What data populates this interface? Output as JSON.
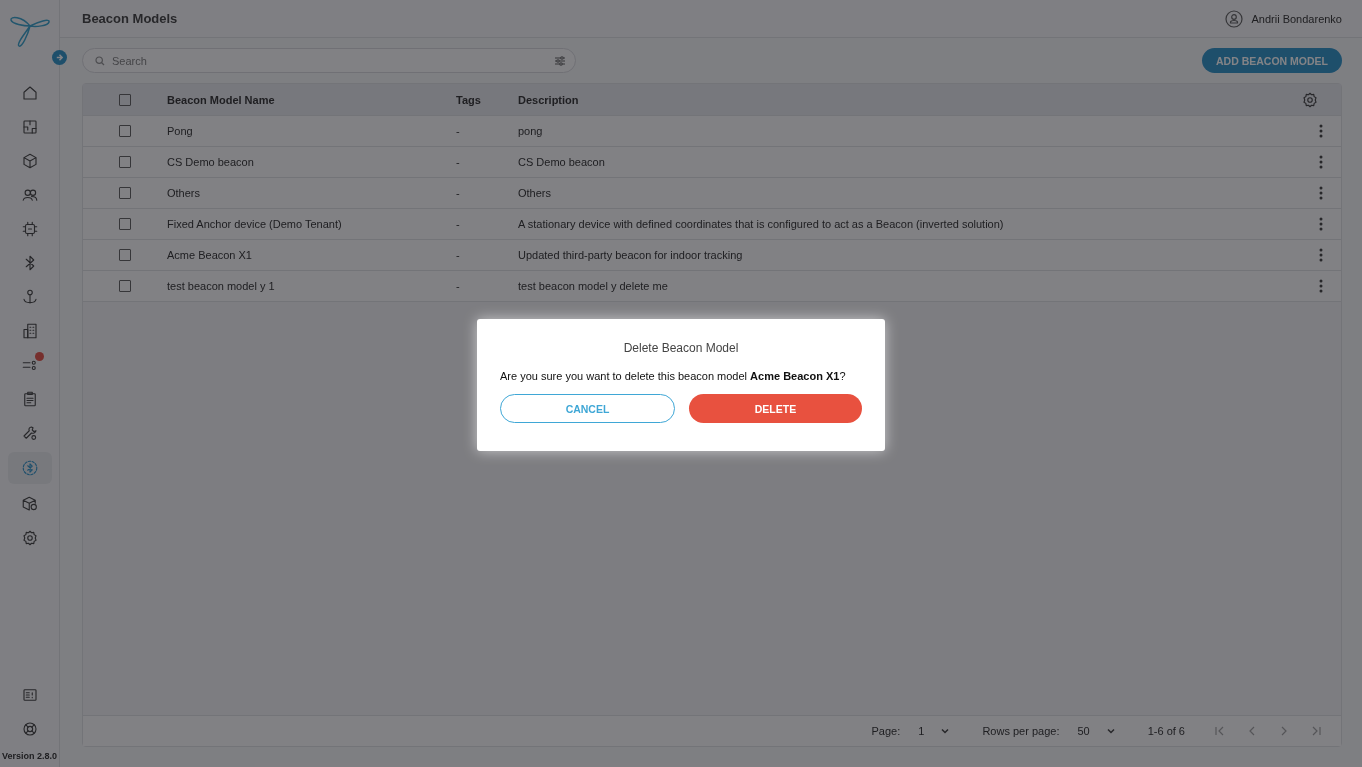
{
  "header": {
    "title": "Beacon Models",
    "user": "Andrii Bondarenko"
  },
  "sidebar": {
    "items": [
      {
        "kind": "home",
        "selected": false
      },
      {
        "kind": "floorplan",
        "selected": false
      },
      {
        "kind": "cube",
        "selected": false
      },
      {
        "kind": "users",
        "selected": false
      },
      {
        "kind": "chip",
        "selected": false
      },
      {
        "kind": "bluetooth",
        "selected": false
      },
      {
        "kind": "anchor",
        "selected": false
      },
      {
        "kind": "building",
        "selected": false
      },
      {
        "kind": "rules",
        "selected": false,
        "badge": true
      },
      {
        "kind": "clipboard",
        "selected": false
      },
      {
        "kind": "wrench",
        "selected": false
      },
      {
        "kind": "bluetooth-circle",
        "selected": true
      },
      {
        "kind": "box-gear",
        "selected": false
      },
      {
        "kind": "gear",
        "selected": false
      }
    ],
    "bottom_items": [
      {
        "kind": "report",
        "selected": false
      },
      {
        "kind": "lifebuoy",
        "selected": false
      }
    ],
    "version": "Version 2.8.0"
  },
  "search": {
    "placeholder": "Search"
  },
  "add_button": "ADD BEACON MODEL",
  "table": {
    "columns": [
      "Beacon Model Name",
      "Tags",
      "Description"
    ],
    "header_checked": false,
    "rows": [
      {
        "name": "Pong",
        "tags": "-",
        "description": "pong",
        "checked": false
      },
      {
        "name": "CS Demo beacon",
        "tags": "-",
        "description": "CS Demo beacon",
        "checked": false
      },
      {
        "name": "Others",
        "tags": "-",
        "description": "Others",
        "checked": false
      },
      {
        "name": "Fixed Anchor device (Demo Tenant)",
        "tags": "-",
        "description": "A stationary device with defined coordinates that is configured to act as a Beacon (inverted solution)",
        "checked": false
      },
      {
        "name": "Acme Beacon X1",
        "tags": "-",
        "description": "Updated third-party beacon for indoor tracking",
        "checked": false
      },
      {
        "name": "test beacon model y 1",
        "tags": "-",
        "description": "test beacon model y delete me",
        "checked": false
      }
    ]
  },
  "pagination": {
    "page_label": "Page:",
    "page": "1",
    "rows_label": "Rows per page:",
    "rows": "50",
    "range": "1-6 of 6"
  },
  "dialog": {
    "title": "Delete Beacon Model",
    "message": "Are you sure you want to delete this beacon model **Acme Beacon X1**?",
    "cancel": "CANCEL",
    "confirm": "DELETE"
  }
}
